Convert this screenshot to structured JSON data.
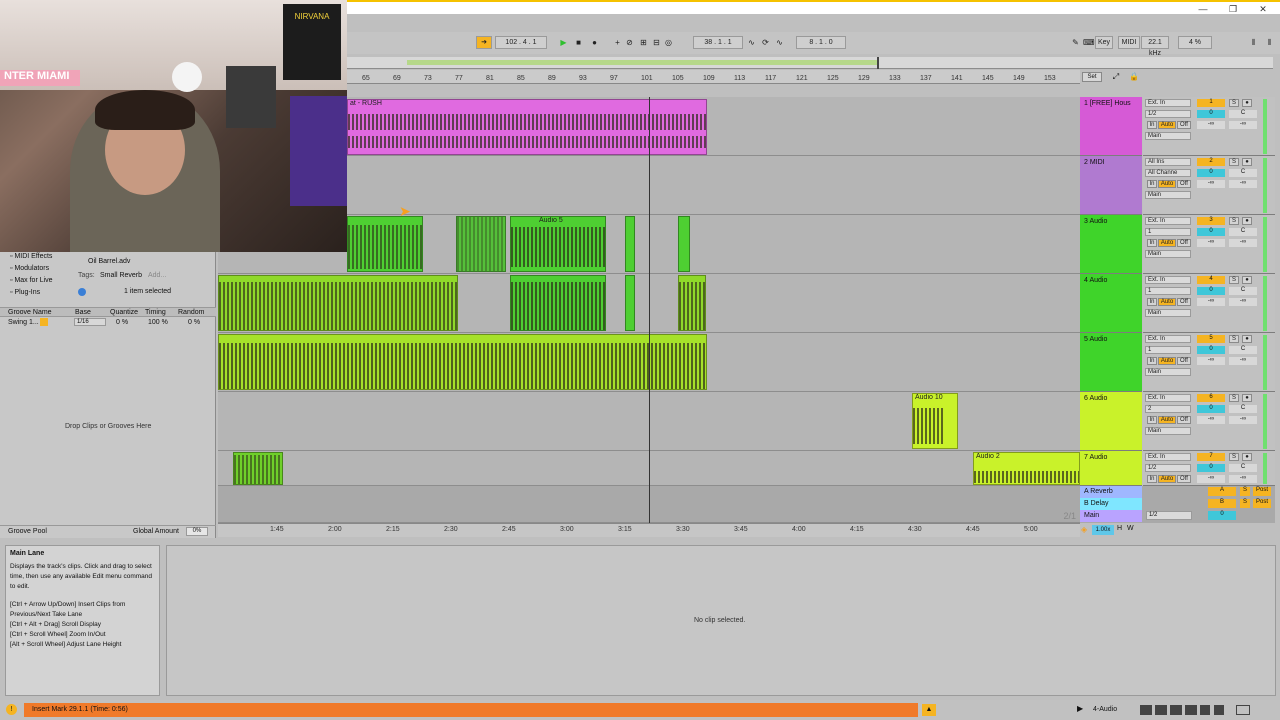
{
  "window": {
    "minimize": "—",
    "restore": "❐",
    "close": "✕"
  },
  "control_bar": {
    "tempo_position": "102 . 4 . 1",
    "arrangement_position": "38 . 1 . 1",
    "loop_length": "8 . 1 . 0",
    "key_label": "Key",
    "midi_label": "MIDI",
    "sample_rate": "22.1 kHz",
    "cpu": "4 %"
  },
  "ruler": {
    "bars": [
      "65",
      "69",
      "73",
      "77",
      "81",
      "85",
      "89",
      "93",
      "97",
      "101",
      "105",
      "109",
      "113",
      "117",
      "121",
      "125",
      "129",
      "133",
      "137",
      "141",
      "145",
      "149",
      "153"
    ],
    "set_button": "Set"
  },
  "tracks": [
    {
      "number": "1",
      "name": "1 [FREE] Hous",
      "input": "Ext. In",
      "channel": "1/2",
      "out": "Main",
      "color": "#d65ad6",
      "volume": "0",
      "pan": "C",
      "sends": "-∞"
    },
    {
      "number": "2",
      "name": "2 MIDI",
      "input": "All Ins",
      "channel": "All Channe",
      "out": "Main",
      "color": "#b07ad0",
      "volume": "0",
      "pan": "C",
      "sends": "-∞"
    },
    {
      "number": "3",
      "name": "3 Audio",
      "input": "Ext. In",
      "channel": "1",
      "out": "Main",
      "color": "#3fd42a",
      "volume": "0",
      "pan": "C",
      "sends": "-∞"
    },
    {
      "number": "4",
      "name": "4 Audio",
      "input": "Ext. In",
      "channel": "1",
      "out": "Main",
      "color": "#3fd42a",
      "volume": "0",
      "pan": "C",
      "sends": "-∞"
    },
    {
      "number": "5",
      "name": "5 Audio",
      "input": "Ext. In",
      "channel": "1",
      "out": "Main",
      "color": "#3fd42a",
      "volume": "0",
      "pan": "C",
      "sends": "-∞"
    },
    {
      "number": "6",
      "name": "6 Audio",
      "input": "Ext. In",
      "channel": "2",
      "out": "Main",
      "color": "#c9f22a",
      "volume": "0",
      "pan": "C",
      "sends": "-∞"
    },
    {
      "number": "7",
      "name": "7 Audio",
      "input": "Ext. In",
      "channel": "1/2",
      "out": "Main",
      "color": "#c9f22a",
      "volume": "0",
      "pan": "C",
      "sends": "-∞"
    }
  ],
  "returns": [
    {
      "name": "A Reverb",
      "letter": "A",
      "post": "Post",
      "color": "#9fb7ff"
    },
    {
      "name": "B Delay",
      "letter": "B",
      "post": "Post",
      "color": "#7fe6ff"
    },
    {
      "name": "Main",
      "letter": "",
      "channel": "1/2",
      "color": "#b9a3ff"
    }
  ],
  "track_controls": {
    "in": "In",
    "auto": "Auto",
    "off": "Off",
    "solo": "S"
  },
  "clips": {
    "track1": "at - RUSH",
    "track3": "Audio 5",
    "track6": "Audio 10",
    "track7": "Audio 2"
  },
  "time_ruler": [
    "1:45",
    "2:00",
    "2:15",
    "2:30",
    "2:45",
    "3:00",
    "3:15",
    "3:30",
    "3:45",
    "4:00",
    "4:15",
    "4:30",
    "4:45",
    "5:00"
  ],
  "page_indicator": "2/1",
  "zoom": "1.00x",
  "browser": {
    "items": [
      "MIDI Effects",
      "Modulators",
      "Max for Live",
      "Plug-Ins"
    ],
    "file": "Oil Barrel.adv",
    "tags_label": "Tags:",
    "tag": "Small Reverb",
    "add": "Add...",
    "selected": "1 item selected",
    "groove_headers": [
      "Groove Name",
      "Base",
      "Quantize",
      "Timing",
      "Random"
    ],
    "groove_row": {
      "name": "Swing 1...",
      "base": "1/16",
      "quantize": "0 %",
      "timing": "100 %",
      "random": "0 %"
    },
    "drop_text": "Drop Clips or Grooves Here",
    "groove_pool": "Groove Pool",
    "global_amount_label": "Global Amount",
    "global_amount": "0%"
  },
  "info": {
    "title": "Main Lane",
    "body": "Displays the track's clips. Click and drag to select time, then use any available Edit menu command to edit.",
    "shortcuts": [
      "[Ctrl + Arrow Up/Down] Insert Clips from Previous/Next Take Lane",
      "[Ctrl + Alt + Drag] Scroll Display",
      "[Ctrl + Scroll Wheel] Zoom In/Out",
      "[Alt + Scroll Wheel] Adjust Lane Height"
    ]
  },
  "clip_view": {
    "empty": "No clip selected."
  },
  "status": {
    "message": "Insert Mark 29.1.1 (Time: 0:56)",
    "track": "4-Audio"
  },
  "webcam": {
    "banner": "NTER MIAMI",
    "poster": "NIRVANA"
  }
}
